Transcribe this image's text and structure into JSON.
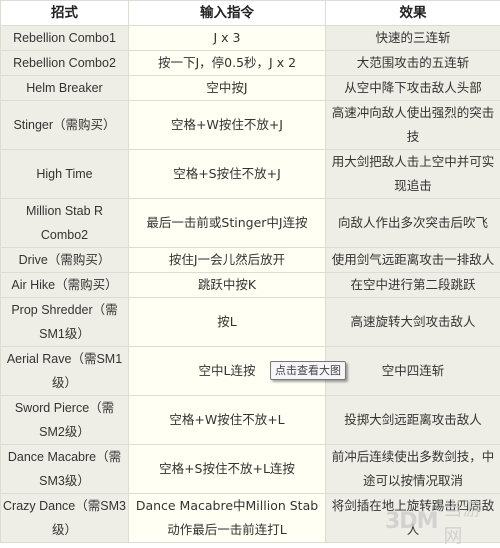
{
  "table": {
    "headers": [
      "招式",
      "输入指令",
      "效果"
    ],
    "rows": [
      {
        "name": "Rebellion Combo1",
        "input": "J x 3",
        "effect": "快速的三连斩"
      },
      {
        "name": "Rebellion Combo2",
        "input": "按一下J，停0.5秒，J x 2",
        "effect": "大范围攻击的五连斩"
      },
      {
        "name": "Helm Breaker",
        "input": "空中按J",
        "effect": "从空中降下攻击敌人头部"
      },
      {
        "name": "Stinger（需购买）",
        "input": "空格+W按住不放+J",
        "effect": "高速冲向敌人使出强烈的突击技"
      },
      {
        "name": "High Time",
        "input": "空格+S按住不放+J",
        "effect": "用大剑把敌人击上空中并可实现追击"
      },
      {
        "name": "Million Stab R Combo2",
        "input": "最后一击前或Stinger中J连按",
        "effect": "向敌人作出多次突击后吹飞"
      },
      {
        "name": "Drive（需购买）",
        "input": "按住J一会儿然后放开",
        "effect": "使用剑气远距离攻击一排敌人"
      },
      {
        "name": "Air Hike（需购买）",
        "input": "跳跃中按K",
        "effect": "在空中进行第二段跳跃"
      },
      {
        "name": "Prop Shredder（需SM1级）",
        "input": "按L",
        "effect": "高速旋转大剑攻击敌人"
      },
      {
        "name": "Aerial Rave（需SM1级）",
        "input": "空中L连按",
        "effect": "空中四连斩"
      },
      {
        "name": "Sword Pierce（需SM2级）",
        "input": "空格+W按住不放+L",
        "effect": "投掷大剑远距离攻击敌人"
      },
      {
        "name": "Dance Macabre（需SM3级）",
        "input": "空格+S按住不放+L连按",
        "effect": "前冲后连续使出多数剑技，中途可以按情况取消"
      },
      {
        "name": "Crazy Dance（需SM3级）",
        "input": "Dance Macabre中Million Stab动作最后一击前连打L",
        "effect": "将剑插在地上旋转踢击四周敌人"
      }
    ]
  },
  "tooltip": "点击查看大图",
  "watermark": {
    "logo": "3DM",
    "text": "当游网"
  }
}
